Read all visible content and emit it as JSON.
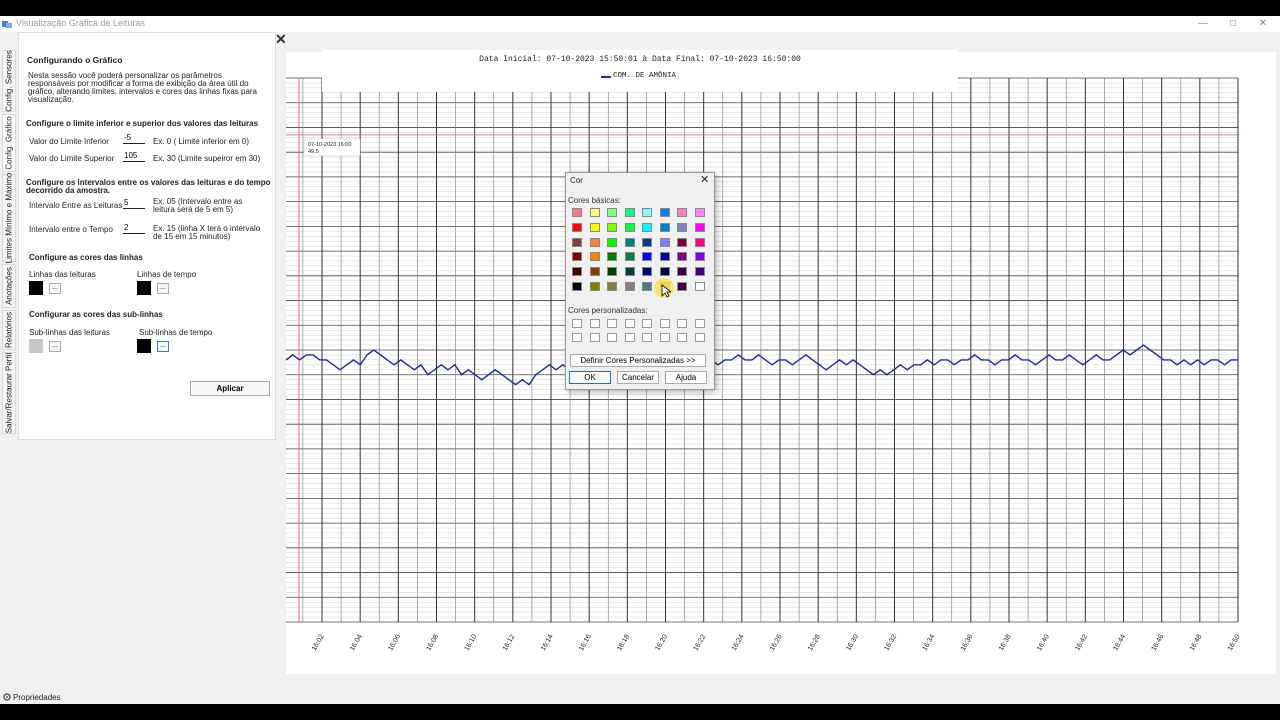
{
  "window": {
    "title": "Visualização Gráfica de Leituras"
  },
  "sidebar_tabs": [
    {
      "label": "Config. Sensores"
    },
    {
      "label": "Config. Gráfico"
    },
    {
      "label": "Limites Mínimo e Máximo"
    },
    {
      "label": "Anotações"
    },
    {
      "label": "Relatórios"
    },
    {
      "label": "Salvar/Restaurar Perfil"
    }
  ],
  "panel": {
    "heading": "Configurando o Gráfico",
    "description_lines": [
      "Nesta sessão você poderá personalizar os parâmetros",
      "responsáveis por modificar a forma de exibição da área útil do",
      "gráfico, alterando limites, intervalos e cores das linhas fixas para",
      "visualização."
    ],
    "limits_section": "Configure o limite inferior e superior dos valores das leituras",
    "lower_limit_label": "Valor do Limite Inferior",
    "lower_limit_value": "-5",
    "lower_limit_hint": "Ex. 0  ( Limite inferior em 0)",
    "upper_limit_label": "Valor do Limite Superior",
    "upper_limit_value": "105",
    "upper_limit_hint": "Ex. 30 (Limite supeiror em 30)",
    "interval_section_lines": [
      "Configure os intervalos entre os valores das leituras e do tempo",
      "decorrido da amostra."
    ],
    "reading_interval_label": "Intervalo Entre as Leituras",
    "reading_interval_value": "5",
    "reading_interval_hint_lines": [
      "Ex. 05 (Intervalo entre as",
      "leitura será de 5 em 5)"
    ],
    "time_interval_label": "Intervalo entre o Tempo",
    "time_interval_value": "2",
    "time_interval_hint_lines": [
      "Ex. 15 (linha X terá o intervalo",
      "de 15 em 15 minutos)"
    ],
    "line_colors_section": "Configure as cores das linhas",
    "reading_lines_label": "Linhas das leituras",
    "time_lines_label": "Linhas de tempo",
    "sublines_section": "Configurar as cores das sub-linhas",
    "reading_sublines_label": "Sub-linhas das leituras",
    "time_sublines_label": "Sub-linhas de tempo",
    "dots_label": "...",
    "apply_button": "Aplicar",
    "colors": {
      "reading_lines": "#000000",
      "time_lines": "#000000",
      "reading_sublines": "#c8c8c8",
      "time_sublines": "#000000"
    }
  },
  "chart_data": {
    "type": "line",
    "title": "Data Inicial: 07-10-2023 15:50:01 à Data Final: 07-10-2023 16:50:00",
    "series": [
      {
        "name": "COM. DE AMÔNIA",
        "color": "#1f2a9e",
        "values": [
          48,
          49,
          48,
          49,
          49,
          48,
          48,
          47,
          46,
          47,
          48,
          47,
          49,
          50,
          49,
          48,
          47,
          48,
          47,
          46,
          47,
          45,
          46,
          47,
          46,
          47,
          45,
          46,
          45,
          44,
          45,
          46,
          45,
          44,
          43,
          44,
          43,
          45,
          46,
          47,
          46,
          47,
          46,
          48,
          47,
          48,
          47,
          48,
          47,
          48,
          48,
          47,
          48,
          48,
          47,
          48,
          47,
          48,
          48,
          47,
          48,
          49,
          48,
          48,
          47,
          48,
          48,
          49,
          48,
          48,
          49,
          48,
          47,
          48,
          48,
          47,
          48,
          49,
          48,
          47,
          46,
          47,
          48,
          47,
          48,
          47,
          46,
          45,
          46,
          45,
          46,
          47,
          46,
          47,
          47,
          48,
          47,
          48,
          48,
          47,
          48,
          48,
          49,
          48,
          48,
          47,
          48,
          48,
          49,
          48,
          48,
          47,
          48,
          49,
          48,
          48,
          49,
          48,
          47,
          48,
          49,
          48,
          48,
          49,
          50,
          49,
          50,
          51,
          50,
          49,
          48,
          48,
          47,
          48,
          47,
          48,
          47,
          48,
          48,
          47,
          48,
          48
        ]
      }
    ],
    "x_tick_labels": [
      "16:02",
      "16:04",
      "16:06",
      "16:08",
      "16:10",
      "16:12",
      "16:14",
      "16:16",
      "16:18",
      "16:20",
      "16:22",
      "16:24",
      "16:26",
      "16:28",
      "16:30",
      "16:32",
      "16:34",
      "16:36",
      "16:38",
      "16:40",
      "16:42",
      "16:44",
      "16:46",
      "16:48",
      "16:50"
    ],
    "ylim": [
      -5,
      105
    ],
    "grid": true,
    "legend": "top-center",
    "marker": {
      "label_time": "07-10-2023 16:00",
      "label_value": "49.5",
      "color": "#e05050"
    }
  },
  "color_dialog": {
    "title": "Cor",
    "close": "✕",
    "basic_colors_label": "Cores básicas:",
    "custom_colors_label": "Cores personalizadas:",
    "define_custom_button": "Definir Cores Personalizadas >>",
    "ok_button": "OK",
    "cancel_button": "Cancelar",
    "help_button": "Ajuda",
    "basic_colors": [
      [
        "#f08080",
        "#ffff80",
        "#80ff80",
        "#00ff80",
        "#80ffff",
        "#0080ff",
        "#ff80c0",
        "#ff80ff"
      ],
      [
        "#ff0000",
        "#ffff00",
        "#80ff00",
        "#00ff40",
        "#00ffff",
        "#0080c0",
        "#8080c0",
        "#ff00ff"
      ],
      [
        "#804040",
        "#ff8040",
        "#00ff00",
        "#008080",
        "#004080",
        "#8080ff",
        "#800040",
        "#ff0080"
      ],
      [
        "#800000",
        "#ff8000",
        "#008000",
        "#008040",
        "#0000ff",
        "#0000a0",
        "#800080",
        "#8000ff"
      ],
      [
        "#400000",
        "#804000",
        "#004000",
        "#004040",
        "#000080",
        "#000040",
        "#400040",
        "#400080"
      ],
      [
        "#000000",
        "#808000",
        "#808040",
        "#808080",
        "#408080",
        "#c0c0c0",
        "#400040",
        "#ffffff"
      ]
    ]
  },
  "status_bar": {
    "label": "Propriedades"
  }
}
